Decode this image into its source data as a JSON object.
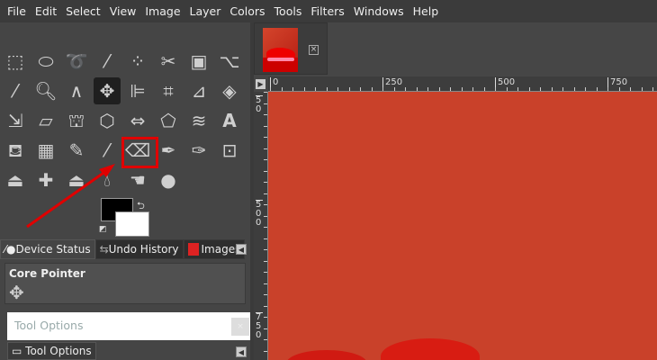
{
  "menu": [
    "File",
    "Edit",
    "Select",
    "View",
    "Image",
    "Layer",
    "Colors",
    "Tools",
    "Filters",
    "Windows",
    "Help"
  ],
  "tools": [
    [
      "rect-select",
      "ellipse-select",
      "free-select",
      "fuzzy-select",
      "select-by-color",
      "scissors-select",
      "foreground-select",
      "paths"
    ],
    [
      "color-picker",
      "zoom",
      "measure",
      "move",
      "align",
      "crop",
      "unified-transform",
      "rotate"
    ],
    [
      "scale",
      "shear",
      "handle-transform",
      "perspective",
      "flip",
      "cage-transform",
      "warp-transform",
      "text"
    ],
    [
      "bucket-fill",
      "gradient",
      "pencil",
      "paintbrush",
      "eraser",
      "airbrush",
      "ink",
      "mypaint-brush"
    ],
    [
      "clone",
      "heal",
      "perspective-clone",
      "blur-sharpen",
      "smudge",
      "dodge-burn"
    ]
  ],
  "active_tool": "move",
  "highlighted_tool": "eraser",
  "annotation_color": "#e00000",
  "colors": {
    "foreground": "#000000",
    "background": "#ffffff"
  },
  "dock_tabs": [
    {
      "label": "Device Status",
      "icon": "device-status-icon"
    },
    {
      "label": "Undo History",
      "icon": "undo-icon"
    },
    {
      "label": "Images",
      "icon": "image-thumb-icon"
    }
  ],
  "device_status": {
    "title": "Core Pointer"
  },
  "tool_options_header": "Tool Options",
  "tool_options_tab": "Tool Options",
  "hruler": [
    "0",
    "250",
    "500",
    "750"
  ],
  "vruler": [
    "50",
    "500",
    "750"
  ],
  "canvas_color": "#c9412a"
}
